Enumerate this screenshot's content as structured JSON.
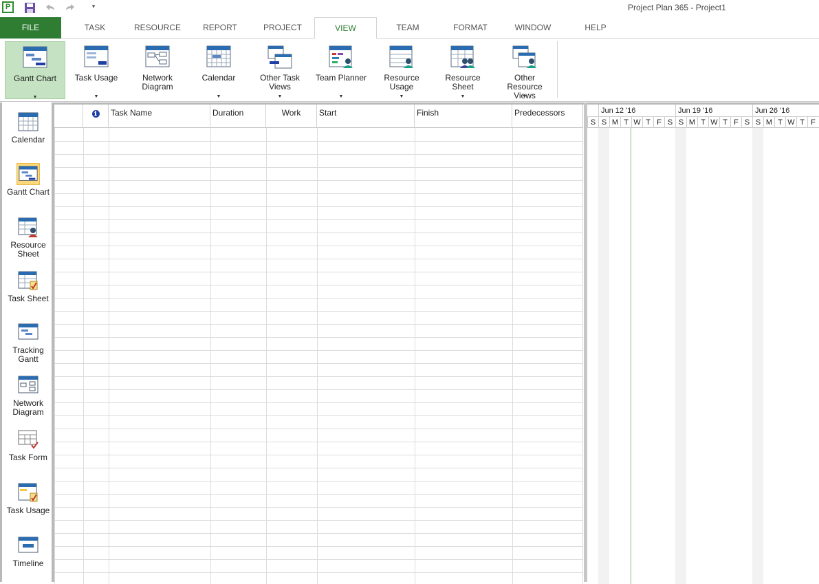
{
  "window": {
    "title": "Project Plan 365 - Project1",
    "app_icon_letter": "P"
  },
  "quick_access": {
    "customize_glyph": "▾"
  },
  "tabs": [
    {
      "label": "FILE"
    },
    {
      "label": "TASK"
    },
    {
      "label": "RESOURCE"
    },
    {
      "label": "REPORT"
    },
    {
      "label": "PROJECT"
    },
    {
      "label": "VIEW"
    },
    {
      "label": "TEAM"
    },
    {
      "label": "FORMAT"
    },
    {
      "label": "WINDOW"
    },
    {
      "label": "HELP"
    }
  ],
  "active_tab": "VIEW",
  "ribbon": {
    "buttons": [
      {
        "label": "Gantt Chart",
        "icon": "gantt-chart-icon"
      },
      {
        "label": "Task Usage",
        "icon": "task-usage-icon"
      },
      {
        "label": "Network\nDiagram",
        "icon": "network-diagram-icon"
      },
      {
        "label": "Calendar",
        "icon": "calendar-icon"
      },
      {
        "label": "Other Task\nViews",
        "icon": "other-task-views-icon"
      },
      {
        "label": "Team Planner",
        "icon": "team-planner-icon"
      },
      {
        "label": "Resource\nUsage",
        "icon": "resource-usage-icon"
      },
      {
        "label": "Resource Sheet",
        "icon": "resource-sheet-icon"
      },
      {
        "label": "Other\nResource Views",
        "icon": "other-resource-views-icon"
      }
    ],
    "dropdown_glyph": "▼",
    "selected": "Gantt Chart"
  },
  "viewbar": {
    "items": [
      {
        "label": "Calendar",
        "icon": "calendar-icon"
      },
      {
        "label": "Gantt Chart",
        "icon": "gantt-chart-icon"
      },
      {
        "label": "Resource\nSheet",
        "icon": "resource-sheet-icon"
      },
      {
        "label": "Task Sheet",
        "icon": "task-sheet-icon"
      },
      {
        "label": "Tracking\nGantt",
        "icon": "tracking-gantt-icon"
      },
      {
        "label": "Network\nDiagram",
        "icon": "network-diagram-icon"
      },
      {
        "label": "Task Form",
        "icon": "task-form-icon"
      },
      {
        "label": "Task Usage",
        "icon": "task-usage-icon"
      },
      {
        "label": "Timeline",
        "icon": "timeline-icon"
      }
    ],
    "selected": "Gantt Chart"
  },
  "table": {
    "columns": [
      {
        "label": ""
      },
      {
        "label": "ℹ",
        "icon": "info-icon"
      },
      {
        "label": "Task Name"
      },
      {
        "label": "Duration"
      },
      {
        "label": "Work"
      },
      {
        "label": "Start"
      },
      {
        "label": "Finish"
      },
      {
        "label": "Predecessors"
      }
    ],
    "rows": []
  },
  "timescale": {
    "weeks": [
      "Jun 12 '16",
      "Jun 19 '16",
      "Jun 26 '16"
    ],
    "days": [
      "S",
      "S",
      "M",
      "T",
      "W",
      "T",
      "F",
      "S",
      "S",
      "M",
      "T",
      "W",
      "T",
      "F",
      "S",
      "S",
      "M",
      "T",
      "W",
      "T",
      "F"
    ],
    "colors": {
      "weekend": "#f2f2f2",
      "today_line": "#7fbf7f"
    }
  },
  "colors": {
    "file_tab": "#2e7d32",
    "accent": "#2e7d32",
    "selected_button": "#c5e3c2",
    "selected_view_icon": "#fbd97a"
  }
}
